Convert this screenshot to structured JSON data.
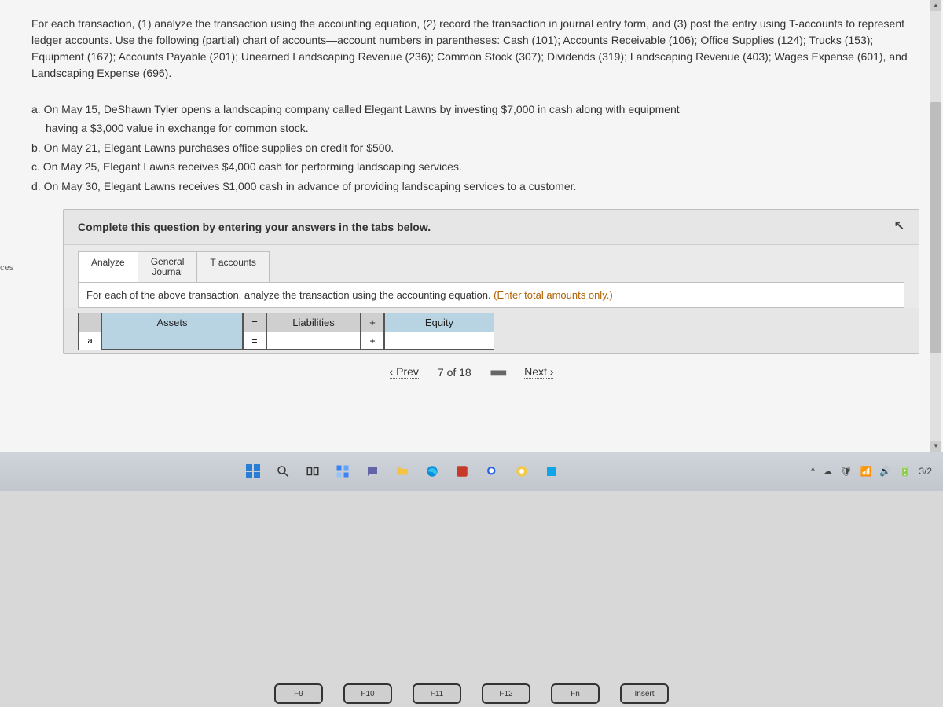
{
  "question": {
    "intro": "For each transaction, (1) analyze the transaction using the accounting equation, (2) record the transaction in journal entry form, and (3) post the entry using T-accounts to represent ledger accounts. Use the following (partial) chart of accounts—account numbers in parentheses: Cash (101); Accounts Receivable (106); Office Supplies (124); Trucks (153); Equipment (167); Accounts Payable (201); Unearned Landscaping Revenue (236); Common Stock (307); Dividends (319); Landscaping Revenue (403); Wages Expense (601), and Landscaping Expense (696).",
    "transactions": {
      "a1": "a. On May 15, DeShawn Tyler opens a landscaping company called Elegant Lawns by investing $7,000 in cash along with equipment",
      "a2": "having a $3,000 value in exchange for common stock.",
      "b": "b. On May 21, Elegant Lawns purchases office supplies on credit for $500.",
      "c": "c. On May 25, Elegant Lawns receives $4,000 cash for performing landscaping services.",
      "d": "d. On May 30, Elegant Lawns receives $1,000 cash in advance of providing landscaping services to a customer."
    }
  },
  "sidebarFragment": "ces",
  "answerPanel": {
    "instruction": "Complete this question by entering your answers in the tabs below.",
    "tabs": {
      "analyze": "Analyze",
      "journal": "General\nJournal",
      "taccounts": "T accounts"
    },
    "tabContent": {
      "lead": "For each of the above transaction, analyze the transaction using the accounting equation. ",
      "hint": "(Enter total amounts only.)"
    },
    "equation": {
      "assets": "Assets",
      "eq": "=",
      "liabilities": "Liabilities",
      "plus": "+",
      "equity": "Equity",
      "rowLabel": "a"
    }
  },
  "pager": {
    "prev": "Prev",
    "count": "7 of 18",
    "next": "Next"
  },
  "taskbar": {
    "rightTime": "3/2"
  },
  "keys": {
    "f9": "F9",
    "f10": "F10",
    "f11": "F11",
    "f12": "F12",
    "fn": "Fn",
    "insert": "Insert"
  }
}
